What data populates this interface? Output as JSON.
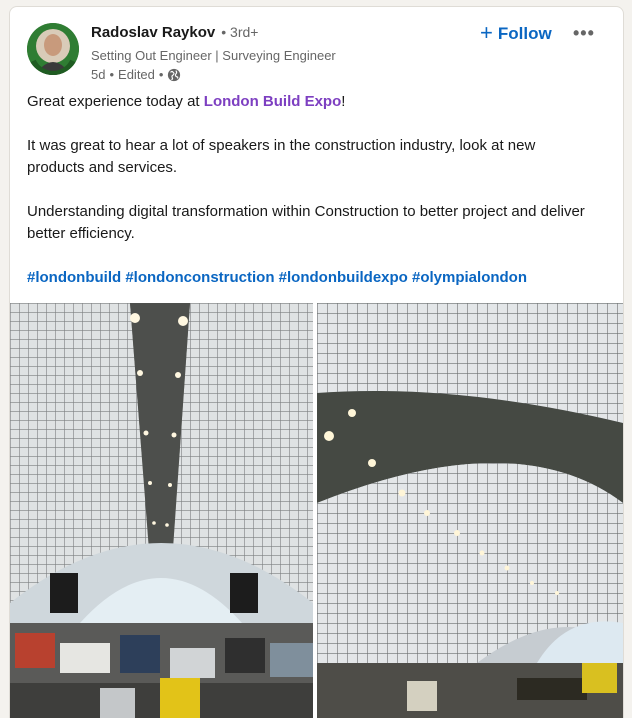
{
  "author": {
    "name": "Radoslav Raykov",
    "degree": "3rd+",
    "headline": "Setting Out Engineer | Surveying Engineer",
    "time": "5d",
    "edited": "Edited"
  },
  "actions": {
    "follow_label": "Follow",
    "follow_icon": "+",
    "more_icon": "•••"
  },
  "post": {
    "line1_prefix": "Great experience today at ",
    "line1_link": "London Build Expo",
    "line1_suffix": "!",
    "para2": "It was great to hear a lot of speakers in the construction industry, look at new products and services.",
    "para3": "Understanding digital transformation within Construction to better project and deliver better efficiency.",
    "hashtags": [
      "#londonbuild",
      "#londonconstruction",
      "#londonbuildexpo",
      "#olympialondon"
    ]
  },
  "colors": {
    "link_blue": "#0a66c2",
    "link_purple": "#7d3fc1",
    "text": "#191919",
    "muted": "#666666"
  }
}
